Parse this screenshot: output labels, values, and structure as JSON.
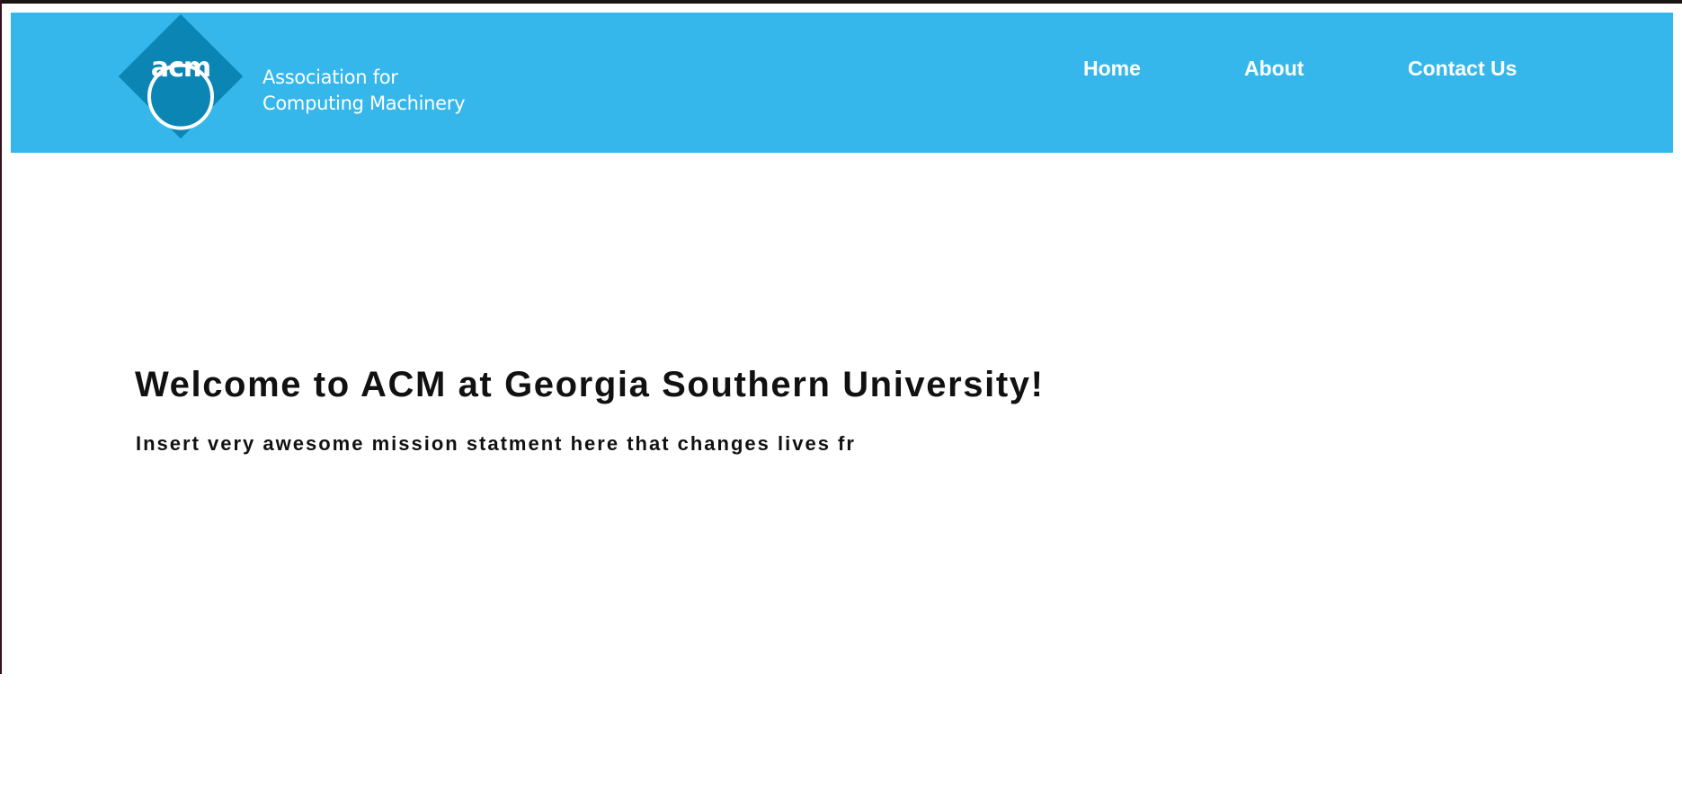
{
  "header": {
    "background_color": "#36b7ec",
    "logo": {
      "abbreviation": "acm",
      "line1": "Association for",
      "line2": "Computing Machinery",
      "mark_color": "#0b86b4"
    },
    "nav": [
      {
        "label": "Home"
      },
      {
        "label": "About"
      },
      {
        "label": "Contact Us"
      }
    ]
  },
  "main": {
    "heading": "Welcome to ACM at Georgia Southern University!",
    "mission": "Insert very awesome mission statment here that changes lives fr"
  }
}
